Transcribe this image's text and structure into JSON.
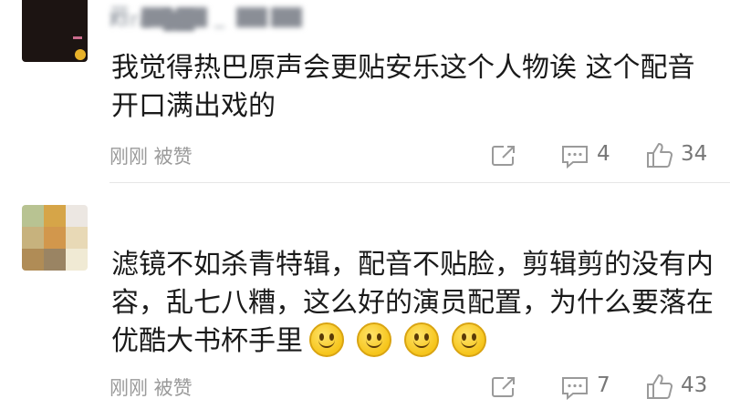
{
  "comments": [
    {
      "text": "我觉得热巴原声会更贴安乐这个人物诶 这个配音开口满出戏的",
      "meta": "刚刚 被赞",
      "replies": "4",
      "likes": "34"
    },
    {
      "text": "滤镜不如杀青特辑，配音不贴脸，剪辑剪的没有内容，乱七八糟，这么好的演员配置，为什么要落在优酷大书杯手里",
      "emoji_count": 4,
      "meta": "刚刚 被赞",
      "replies": "7",
      "likes": "43"
    }
  ],
  "icons": {
    "share": "share-out-icon",
    "reply": "comment-bubble-icon",
    "like": "thumbs-up-icon",
    "emoji": "smile-emoji-icon"
  },
  "colors": {
    "text": "#1a1a1a",
    "meta": "#9a9a9a",
    "emoji": "#f6c51b"
  }
}
